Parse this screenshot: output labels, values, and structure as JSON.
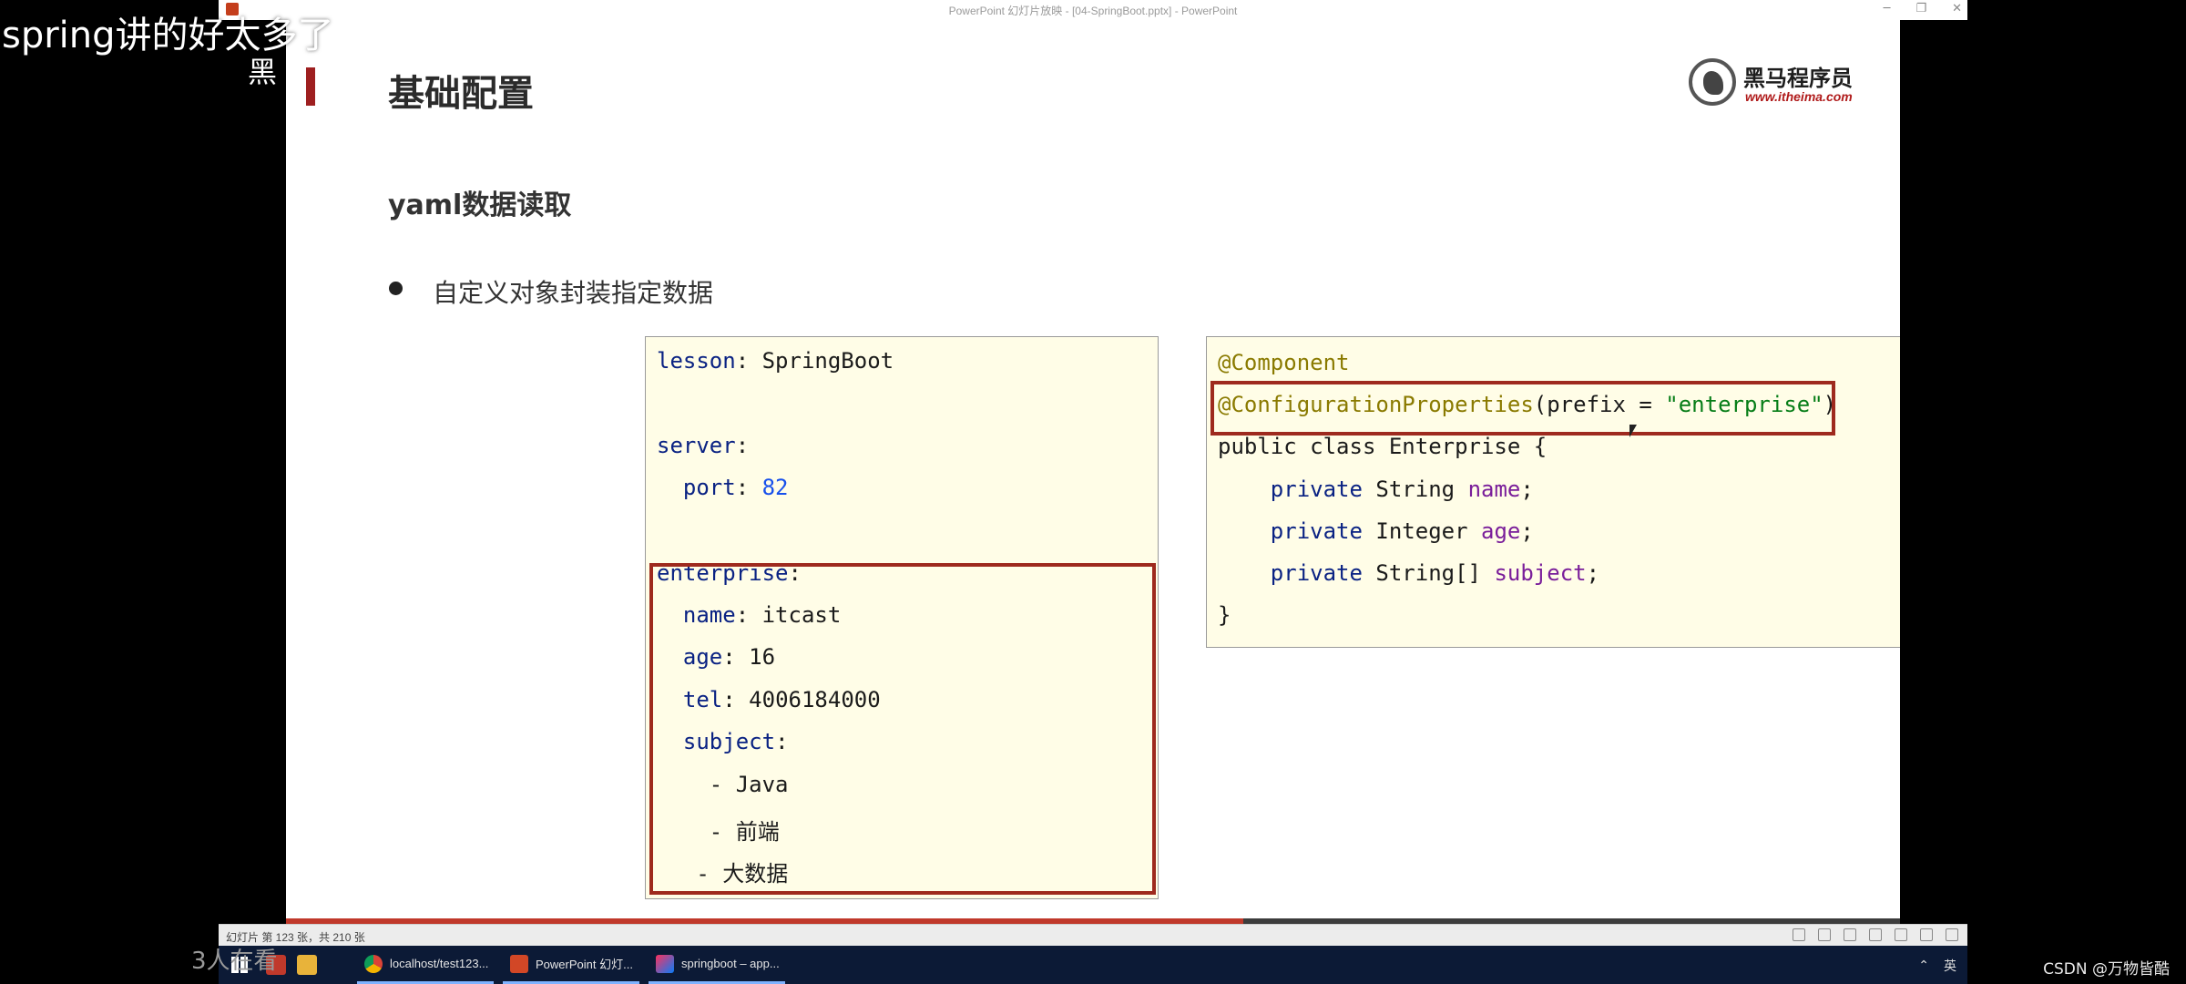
{
  "window": {
    "title": "PowerPoint 幻灯片放映 - [04-SpringBoot.pptx] - PowerPoint",
    "controls": [
      "─",
      "❐",
      "✕"
    ]
  },
  "overlay": {
    "danmaku": "spring讲的好太多了",
    "partial": "黑",
    "watching": "3人在看"
  },
  "slide": {
    "title": "基础配置",
    "logo_cn": "黑马程序员",
    "logo_url": "www.itheima.com",
    "subtitle": "yaml数据读取",
    "bullet": "自定义对象封装指定数据",
    "yaml": {
      "l1_key": "lesson",
      "l1_val": "SpringBoot",
      "l2_key": "server",
      "l3_key": "port",
      "l3_val": "82",
      "l4_key": "enterprise",
      "l5_key": "name",
      "l5_val": "itcast",
      "l6_key": "age",
      "l6_val": "16",
      "l7_key": "tel",
      "l7_val": "4006184000",
      "l8_key": "subject",
      "l9": "- Java",
      "l10": "- 前端",
      "l11": "- 大数据"
    },
    "java": {
      "ann1": "@Component",
      "ann2": "@ConfigurationProperties",
      "ann2_args_open": "(prefix = ",
      "ann2_str": "\"enterprise\"",
      "ann2_args_close": ")",
      "class_decl": "public class Enterprise {",
      "f1_kw": "private",
      "f1_type": "String",
      "f1_name": "name",
      "f2_kw": "private",
      "f2_type": "Integer",
      "f2_name": "age",
      "f3_kw": "private",
      "f3_type": "String[]",
      "f3_name": "subject",
      "close": "}"
    },
    "progress_fraction": 0.5857
  },
  "status": {
    "slide_info": "幻灯片 第 123 张，共 210 张"
  },
  "taskbar": {
    "items": [
      {
        "label": "localhost/test123..."
      },
      {
        "label": "PowerPoint 幻灯..."
      },
      {
        "label": "springboot – app..."
      }
    ],
    "ime": "英"
  },
  "watermark": "CSDN @万物皆酷",
  "colors": {
    "accent_red": "#9e2a1e",
    "code_bg": "#fffde7",
    "progress": "#c0392b"
  }
}
